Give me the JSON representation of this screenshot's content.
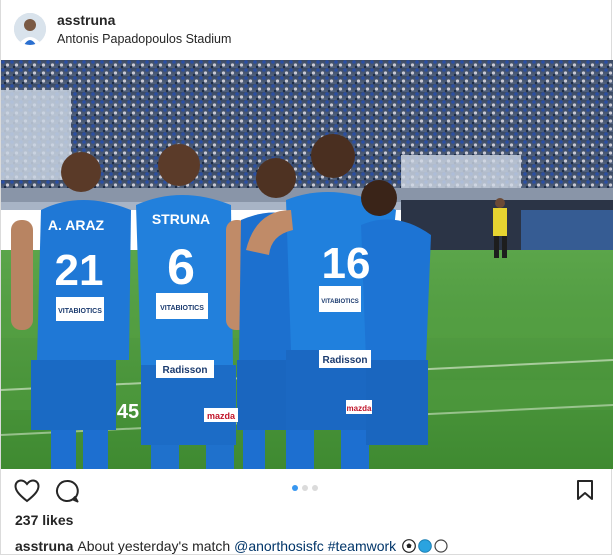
{
  "post": {
    "username": "asstruna",
    "location": "Antonis Papadopoulos Stadium",
    "likes": "237 likes",
    "caption": {
      "username": "asstruna",
      "text": "About yesterday's match ",
      "mention": "@anorthosisfc",
      "hashtag": "#teamwork",
      "emojis": [
        "soccer-ball-emoji",
        "blue-circle-emoji",
        "white-circle-emoji"
      ]
    },
    "carousel": {
      "count": 3,
      "active_index": 0
    }
  },
  "photo": {
    "jerseys": [
      {
        "name": "A. ARAZ",
        "number": "21"
      },
      {
        "name": "STRUNA",
        "number": "6"
      },
      {
        "name": "",
        "number": "16"
      },
      {
        "name": "",
        "number": "45"
      }
    ],
    "sponsors": [
      "VITABIOTICS",
      "Radisson",
      "mazda"
    ]
  },
  "colors": {
    "jersey_blue": "#1f78d6",
    "pitch_green": "#4f9a3c",
    "link_blue": "#003569",
    "active_dot": "#3897f0"
  }
}
